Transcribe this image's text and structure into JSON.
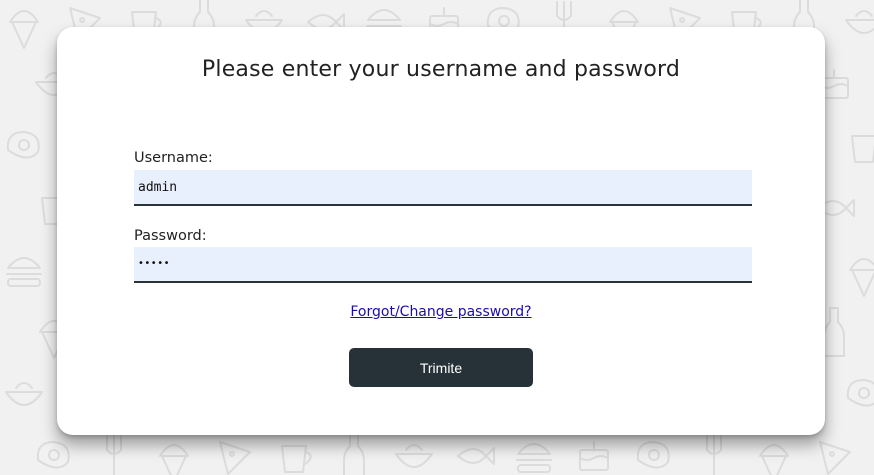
{
  "colors": {
    "background": "#f1f1f1",
    "pattern_stroke": "#dcdcdc",
    "card": "#ffffff",
    "input_background": "#e8f0fe",
    "input_underline": "#2a3338",
    "button_background": "#263238",
    "button_text": "#ffffff",
    "link": "#1a0dab"
  },
  "background": {
    "pattern": "food-doodle-icons"
  },
  "login": {
    "title": "Please enter your username and password",
    "username_label": "Username:",
    "username_value": "admin",
    "password_label": "Password:",
    "password_masked": "•••••",
    "forgot_link": "Forgot/Change password?",
    "submit_label": "Trimite"
  }
}
